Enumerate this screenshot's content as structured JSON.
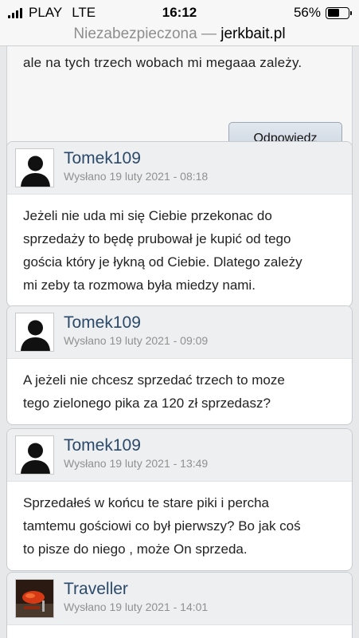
{
  "status_bar": {
    "carrier": "PLAY",
    "network": "LTE",
    "time": "16:12",
    "battery_text": "56%",
    "battery_level": 0.56
  },
  "address_bar": {
    "security_label": "Niezabezpieczona —",
    "domain": "jerkbait.pl"
  },
  "previous_post": {
    "tail_text": "ale na tych trzech wobach mi megaaa zależy.",
    "reply_label": "Odpowiedz"
  },
  "posts": [
    {
      "author": "Tomek109",
      "posted": "Wysłano 19 luty 2021 - 08:18",
      "avatar": "default-avatar-icon",
      "lines": [
        "Jeżeli nie uda mi się Ciebie przekonac do",
        "sprzedaży to będę prubował je kupić od tego",
        "gościa który je łykną od Ciebie. Dlatego zależy",
        "mi zeby ta rozmowa była miedzy nami."
      ]
    },
    {
      "author": "Tomek109",
      "posted": "Wysłano 19 luty 2021 - 09:09",
      "avatar": "default-avatar-icon",
      "lines": [
        "A jeżeli nie chcesz sprzedać trzech to moze",
        "tego zielonego pika za 120 zł sprzedasz?"
      ]
    },
    {
      "author": "Tomek109",
      "posted": "Wysłano 19 luty 2021 - 13:49",
      "avatar": "default-avatar-icon",
      "lines": [
        "Sprzedałeś w końcu te stare piki i percha",
        "tamtemu gościowi co był pierwszy? Bo jak coś",
        "to pisze do niego , może On sprzeda."
      ]
    },
    {
      "author": "Traveller",
      "posted": "Wysłano 19 luty 2021 - 14:01",
      "avatar": "user-photo-avatar",
      "lines": []
    }
  ],
  "colors": {
    "author_link": "#2b4a6a",
    "header_bg": "#eeeff1",
    "page_bg": "#e7e8ea"
  }
}
